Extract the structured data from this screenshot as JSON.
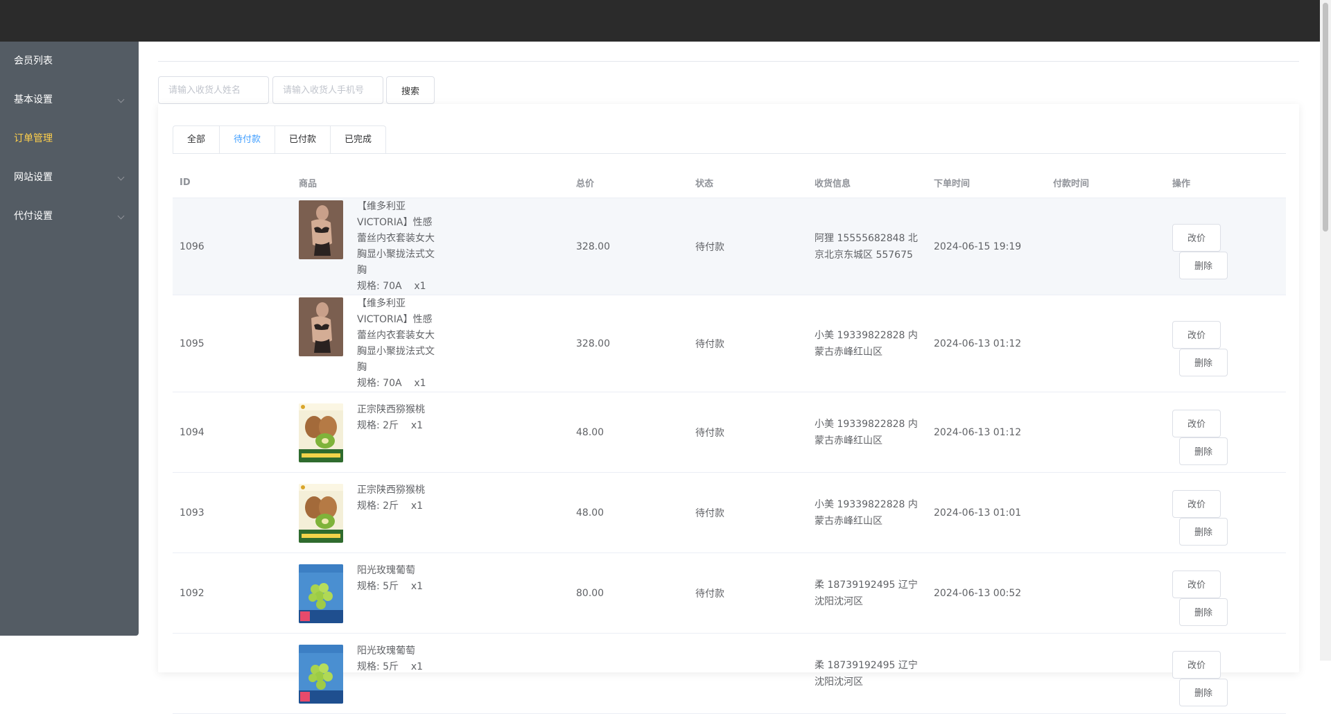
{
  "nav": [
    {
      "label": "会员列表",
      "has_submenu": false,
      "active": false
    },
    {
      "label": "基本设置",
      "has_submenu": true,
      "active": false
    },
    {
      "label": "订单管理",
      "has_submenu": false,
      "active": true
    },
    {
      "label": "网站设置",
      "has_submenu": true,
      "active": false
    },
    {
      "label": "代付设置",
      "has_submenu": true,
      "active": false
    }
  ],
  "search": {
    "name_placeholder": "请输入收货人姓名",
    "phone_placeholder": "请输入收货人手机号",
    "button_label": "搜索"
  },
  "tabs": [
    "全部",
    "待付款",
    "已付款",
    "已完成"
  ],
  "active_tab": "待付款",
  "table": {
    "headers": {
      "id": "ID",
      "goods": "商品",
      "total": "总价",
      "status": "状态",
      "address": "收货信息",
      "order_time": "下单时间",
      "pay_time": "付款时间",
      "actions": "操作"
    },
    "edit_label": "改价",
    "delete_label": "删除",
    "rows": [
      {
        "id": "1096",
        "goods_name": "【维多利亚 VICTORIA】性感蕾丝内衣套装女大胸显小聚拢法式文胸",
        "spec": "规格: 70A    x1",
        "image": "lingerie-photo",
        "total": "328.00",
        "status": "待付款",
        "address": "阿狸 15555682848 北京北京东城区 557675",
        "order_time": "2024-06-15 19:19",
        "pay_time": ""
      },
      {
        "id": "1095",
        "goods_name": "【维多利亚 VICTORIA】性感蕾丝内衣套装女大胸显小聚拢法式文胸",
        "spec": "规格: 70A    x1",
        "image": "lingerie-photo",
        "total": "328.00",
        "status": "待付款",
        "address": "小美 19339822828 内蒙古赤峰红山区",
        "order_time": "2024-06-13 01:12",
        "pay_time": ""
      },
      {
        "id": "1094",
        "goods_name": "正宗陕西猕猴桃",
        "spec": "规格: 2斤    x1",
        "image": "kiwi-photo",
        "total": "48.00",
        "status": "待付款",
        "address": "小美 19339822828 内蒙古赤峰红山区",
        "order_time": "2024-06-13 01:12",
        "pay_time": ""
      },
      {
        "id": "1093",
        "goods_name": "正宗陕西猕猴桃",
        "spec": "规格: 2斤    x1",
        "image": "kiwi-photo",
        "total": "48.00",
        "status": "待付款",
        "address": "小美 19339822828 内蒙古赤峰红山区",
        "order_time": "2024-06-13 01:01",
        "pay_time": ""
      },
      {
        "id": "1092",
        "goods_name": "阳光玫瑰葡萄",
        "spec": "规格: 5斤    x1",
        "image": "grape-photo",
        "total": "80.00",
        "status": "待付款",
        "address": "柔 18739192495 辽宁沈阳沈河区",
        "order_time": "2024-06-13 00:52",
        "pay_time": ""
      },
      {
        "id": "",
        "goods_name": "阳光玫瑰葡萄",
        "spec": "规格: 5斤    x1",
        "image": "grape-photo",
        "total": "",
        "status": "",
        "address": "柔 18739192495 辽宁沈阳沈河区",
        "order_time": "",
        "pay_time": ""
      }
    ]
  },
  "colors": {
    "topbar": "#2b2b2b",
    "sidebar": "#545c64",
    "active_nav": "#ffd04b",
    "active_tab": "#409eff"
  }
}
